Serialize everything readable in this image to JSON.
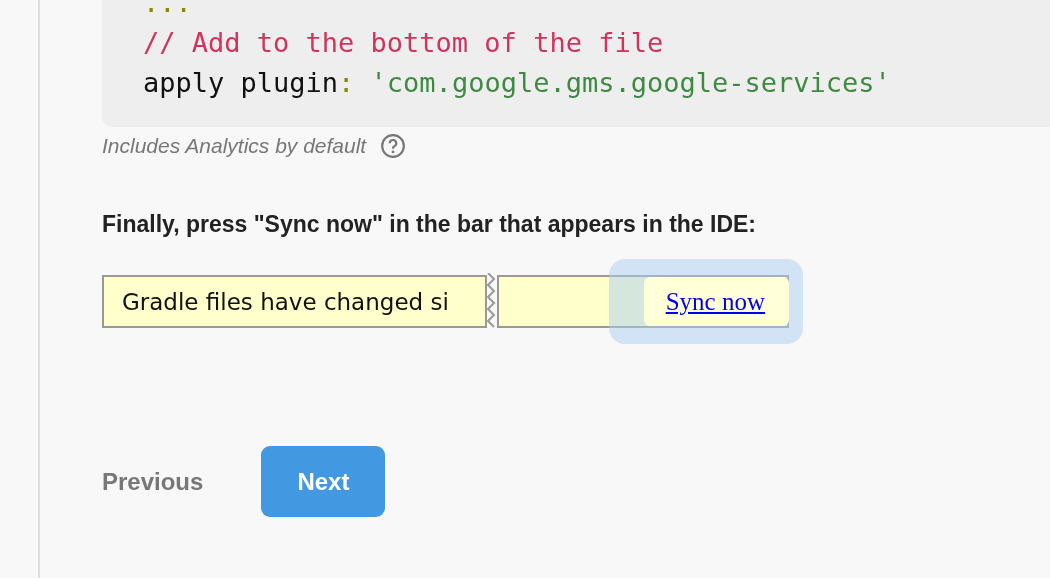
{
  "code_block": {
    "lines": [
      {
        "tokens": [
          {
            "kind": "punct",
            "text": "..."
          }
        ]
      },
      {
        "tokens": [
          {
            "kind": "comment",
            "text": "// Add to the bottom of the file"
          }
        ]
      },
      {
        "tokens": [
          {
            "kind": "plain",
            "text": "apply plugin"
          },
          {
            "kind": "punct",
            "text": ":"
          },
          {
            "kind": "string",
            "text": " 'com.google.gms.google-services'"
          }
        ]
      }
    ]
  },
  "caption": "Includes Analytics by default",
  "instruction": "Finally, press \"Sync now\" in the bar that appears in the IDE:",
  "ide_bar": {
    "message": "Gradle files have changed si",
    "link": "Sync now"
  },
  "nav": {
    "previous": "Previous",
    "next": "Next"
  }
}
